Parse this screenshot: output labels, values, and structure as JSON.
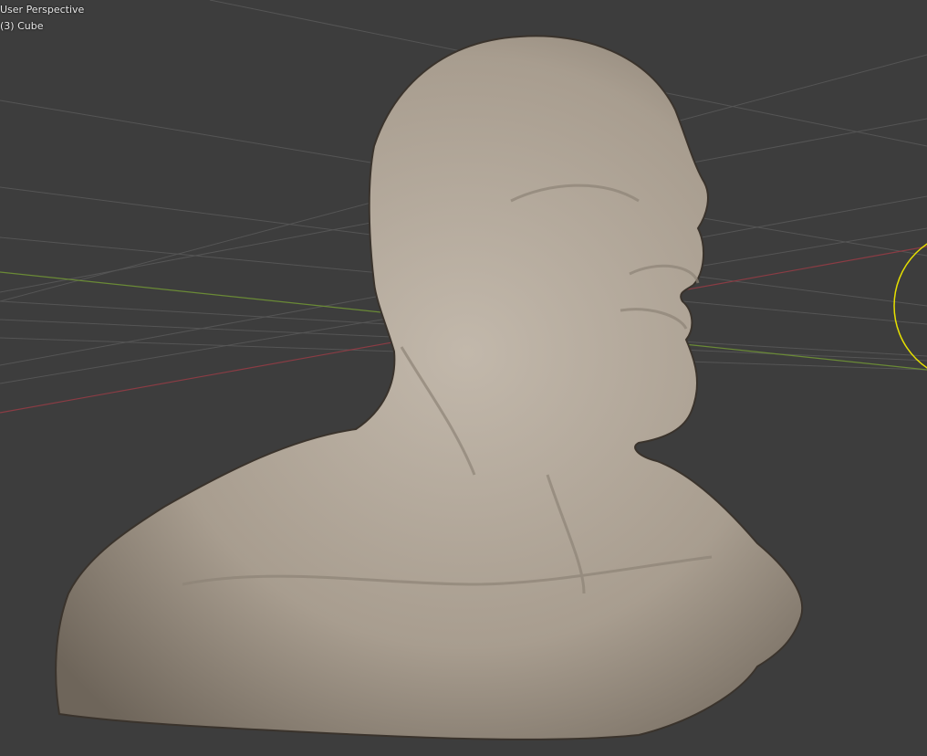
{
  "viewport": {
    "view_name": "User Perspective",
    "active_object": "(3) Cube",
    "colors": {
      "background": "#3d3d3d",
      "grid": "#4e4e4e",
      "x_axis": "#8a3c44",
      "y_axis": "#6a8a36",
      "light_gizmo": "#e6e000",
      "mesh": "#a79c8e"
    }
  }
}
